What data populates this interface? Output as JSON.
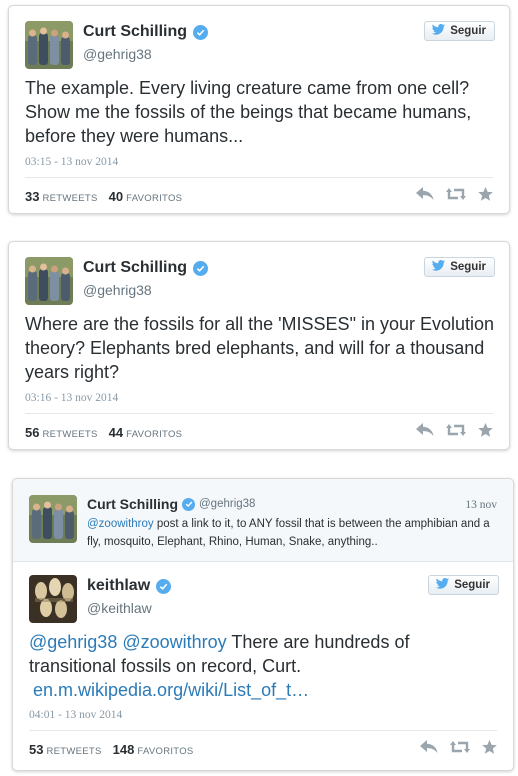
{
  "tweets": [
    {
      "author": "Curt Schilling",
      "handle": "@gehrig38",
      "follow_label": "Seguir",
      "text": "The example. Every living creature came from one cell? Show me the fossils of the beings that became humans, before they were humans...",
      "time": "03:15 - 13 nov 2014",
      "retweets": "33",
      "retweets_label": "RETWEETS",
      "favorites": "40",
      "favorites_label": "FAVORITOS"
    },
    {
      "author": "Curt Schilling",
      "handle": "@gehrig38",
      "follow_label": "Seguir",
      "text": "Where are the fossils for all the 'MISSES\" in your Evolution theory? Elephants bred elephants, and will for a thousand years right?",
      "time": "03:16 - 13 nov 2014",
      "retweets": "56",
      "retweets_label": "RETWEETS",
      "favorites": "44",
      "favorites_label": "FAVORITOS"
    }
  ],
  "reply": {
    "quoted": {
      "author": "Curt Schilling",
      "handle": "@gehrig38",
      "date": "13 nov",
      "mention": "@zoowithroy",
      "text": " post a link to it, to ANY fossil that is between the amphibian and a fly, mosquito, Elephant, Rhino, Human, Snake, anything.."
    },
    "author": "keithlaw",
    "handle": "@keithlaw",
    "follow_label": "Seguir",
    "mention1": "@gehrig38",
    "mention2": "@zoowithroy",
    "text": " There are hundreds of transitional fossils on record, Curt.",
    "url": "en.m.wikipedia.org/wiki/List_of_t…",
    "time": "04:01 - 13 nov 2014",
    "retweets": "53",
    "retweets_label": "RETWEETS",
    "favorites": "148",
    "favorites_label": "FAVORITOS"
  },
  "colors": {
    "verified": "#55acee",
    "link": "#2b7bb9",
    "twitter_bird": "#55acee"
  },
  "icons": [
    "verified-badge-icon",
    "twitter-bird-icon",
    "reply-icon",
    "retweet-icon",
    "favorite-star-icon"
  ]
}
